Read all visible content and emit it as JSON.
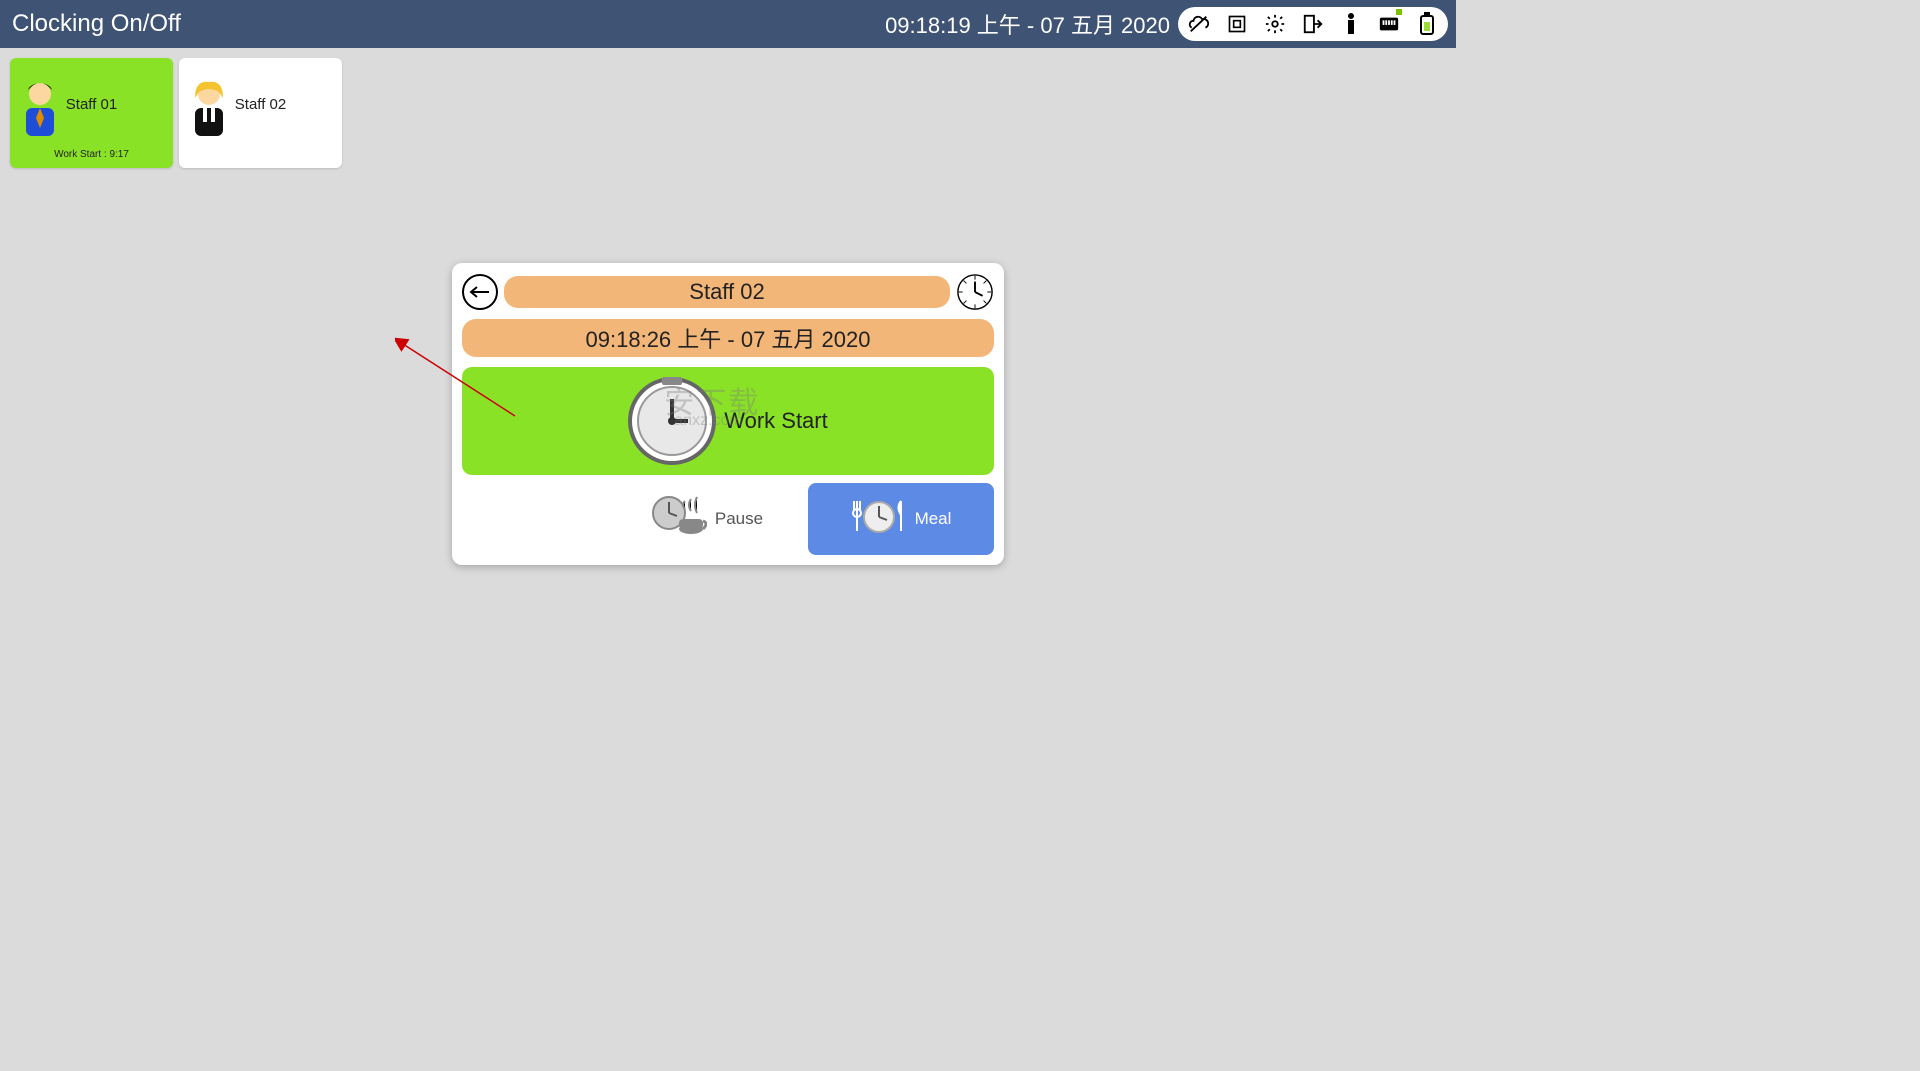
{
  "header": {
    "title": "Clocking On/Off",
    "clock": "09:18:19 上午 - 07 五月 2020"
  },
  "tray_icons": [
    "cloud-off-icon",
    "fullscreen-icon",
    "gear-icon",
    "logout-icon",
    "info-icon",
    "plug-icon",
    "battery-icon"
  ],
  "staff": [
    {
      "name": "Staff 01",
      "sub": "Work Start : 9:17",
      "active": true
    },
    {
      "name": "Staff 02",
      "sub": "",
      "active": false
    }
  ],
  "dialog": {
    "staff_name": "Staff 02",
    "time": "09:18:26 上午 - 07 五月 2020",
    "work_start_label": "Work Start",
    "pause_label": "Pause",
    "meal_label": "Meal"
  },
  "watermark": {
    "line1": "安下载",
    "line2": "anxz.com"
  }
}
